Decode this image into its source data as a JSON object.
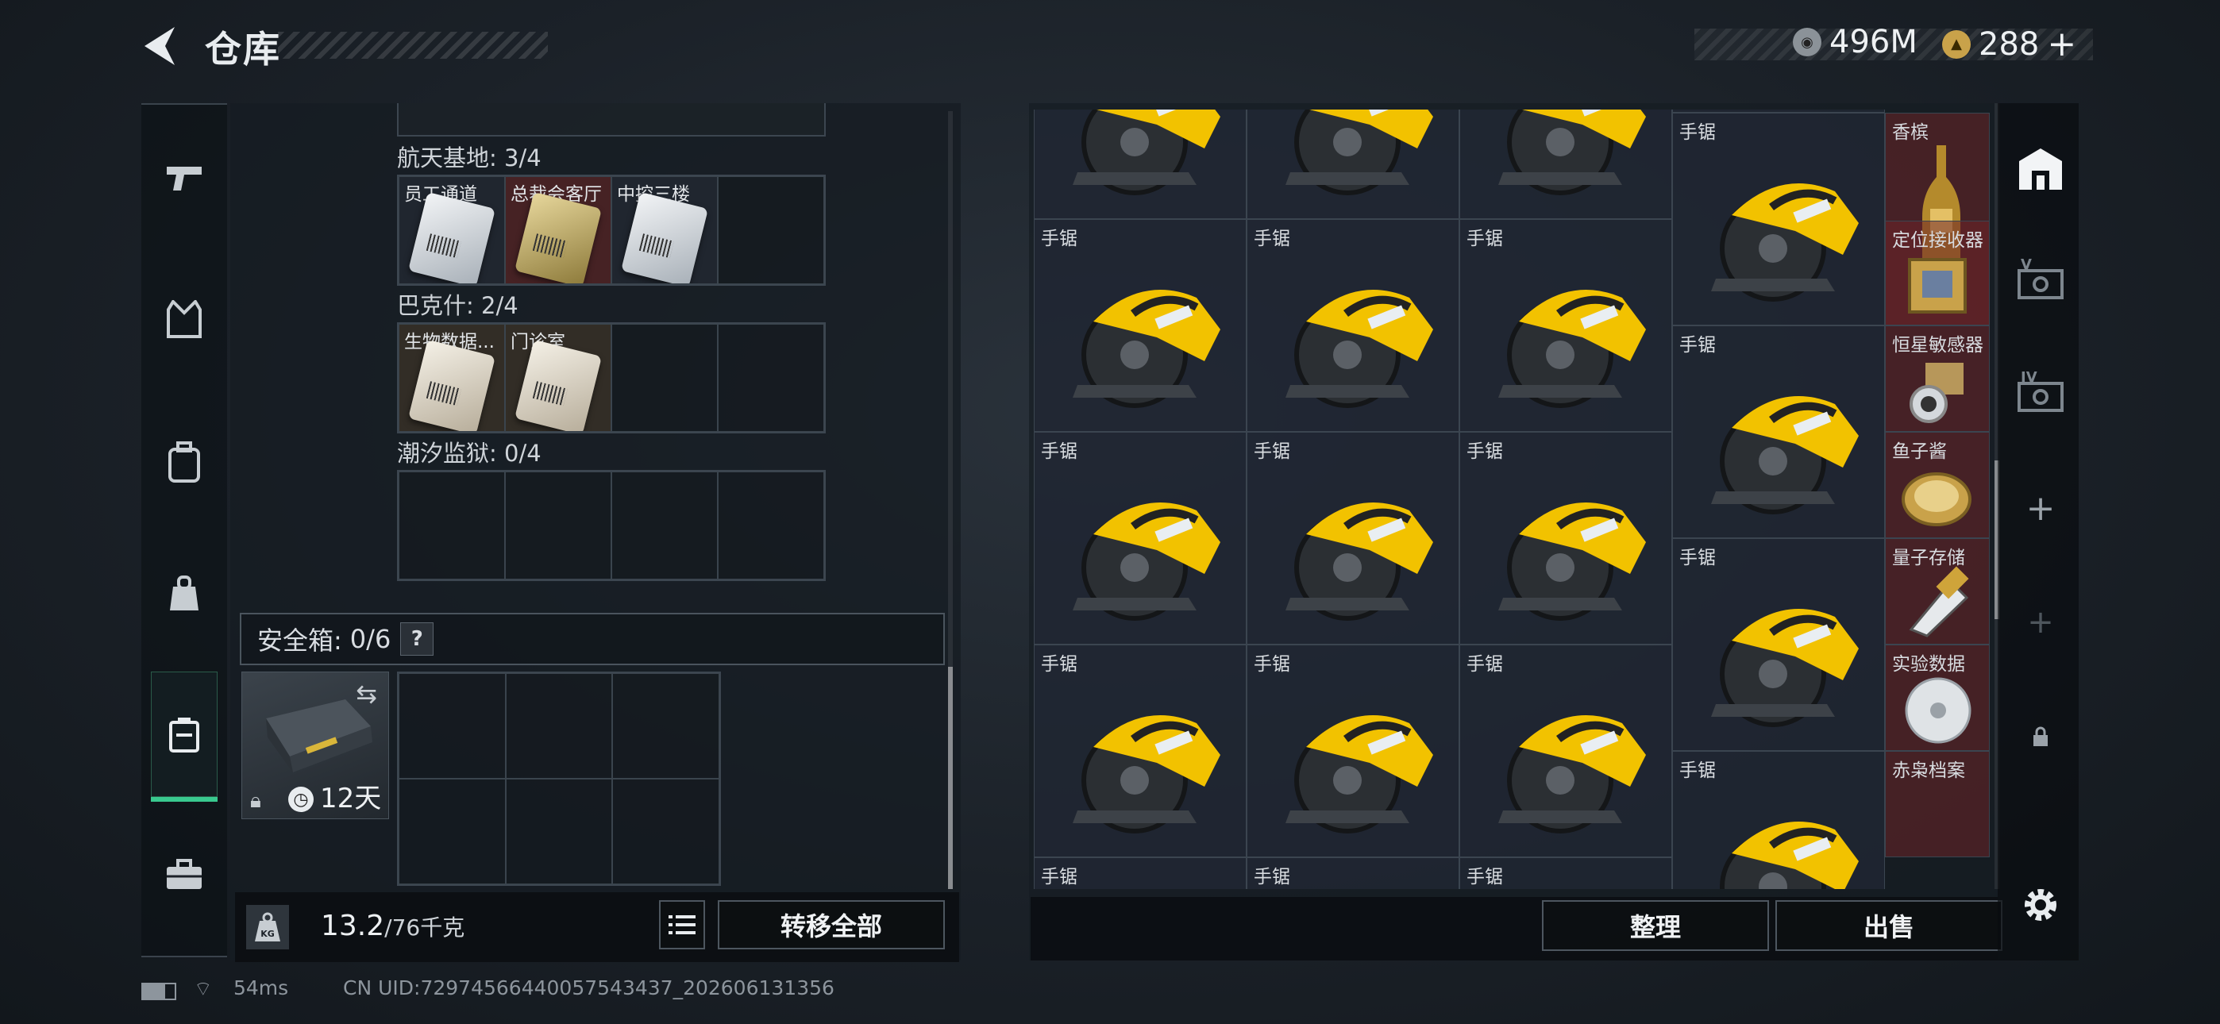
{
  "header": {
    "title": "仓库",
    "currency1": "496M",
    "currency2": "288",
    "currency2_add": "+"
  },
  "left": {
    "sections": [
      {
        "label": "航天基地: 3/4",
        "cells": [
          {
            "label": "员工通道",
            "card": "silver"
          },
          {
            "label": "总裁会客厅",
            "card": "gold"
          },
          {
            "label": "中控三楼",
            "card": "silver"
          },
          {
            "label": "",
            "card": ""
          }
        ]
      },
      {
        "label": "巴克什: 2/4",
        "cells": [
          {
            "label": "生物数据...",
            "card": "tan"
          },
          {
            "label": "门诊室",
            "card": "tan"
          },
          {
            "label": "",
            "card": ""
          },
          {
            "label": "",
            "card": ""
          }
        ]
      },
      {
        "label": "潮汐监狱: 0/4",
        "cells": [
          {
            "label": "",
            "card": ""
          },
          {
            "label": "",
            "card": ""
          },
          {
            "label": "",
            "card": ""
          },
          {
            "label": "",
            "card": ""
          }
        ]
      }
    ],
    "safe": {
      "label": "安全箱:",
      "count": "0/6",
      "help": "?",
      "timer": "12天"
    },
    "weight": {
      "value": "13.2",
      "max": "/76千克"
    },
    "transfer_all": "转移全部"
  },
  "right": {
    "saw_label": "手锯",
    "side_items": [
      {
        "label": "香槟"
      },
      {
        "label": "定位接收器"
      },
      {
        "label": "恒星敏感器"
      },
      {
        "label": "鱼子酱"
      },
      {
        "label": "量子存储"
      },
      {
        "label": "实验数据"
      },
      {
        "label": "赤枭档案"
      }
    ],
    "sort_button": "整理",
    "sell_button": "出售"
  },
  "right_nav": [
    "V",
    "IV",
    "+",
    "+"
  ],
  "status": {
    "ping": "54ms",
    "uid": "CN UID:72974566440057543437_202606131356"
  },
  "colors": {
    "accent": "#39c98f",
    "saw_yellow": "#f2c200",
    "red_cell": "#6e2428"
  }
}
